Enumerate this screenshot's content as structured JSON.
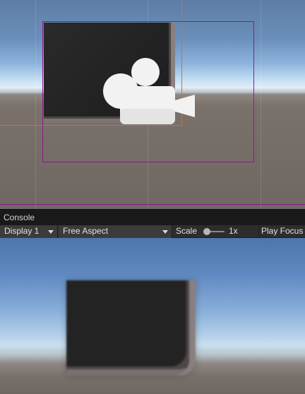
{
  "console_tab": {
    "label": "Console"
  },
  "toolbar": {
    "display": "Display 1",
    "aspect": "Free Aspect",
    "scale_label": "Scale",
    "scale_value": "1x",
    "scale_level": 0.0,
    "play_focus": "Play Focus"
  },
  "colors": {
    "selection_orange": "#d9701c",
    "selection_purple": "#8c1a8c",
    "editor_dark": "#2d2d2d"
  },
  "icons": {
    "scene_camera": "camera-icon",
    "dropdown": "dropdown-caret-icon"
  }
}
